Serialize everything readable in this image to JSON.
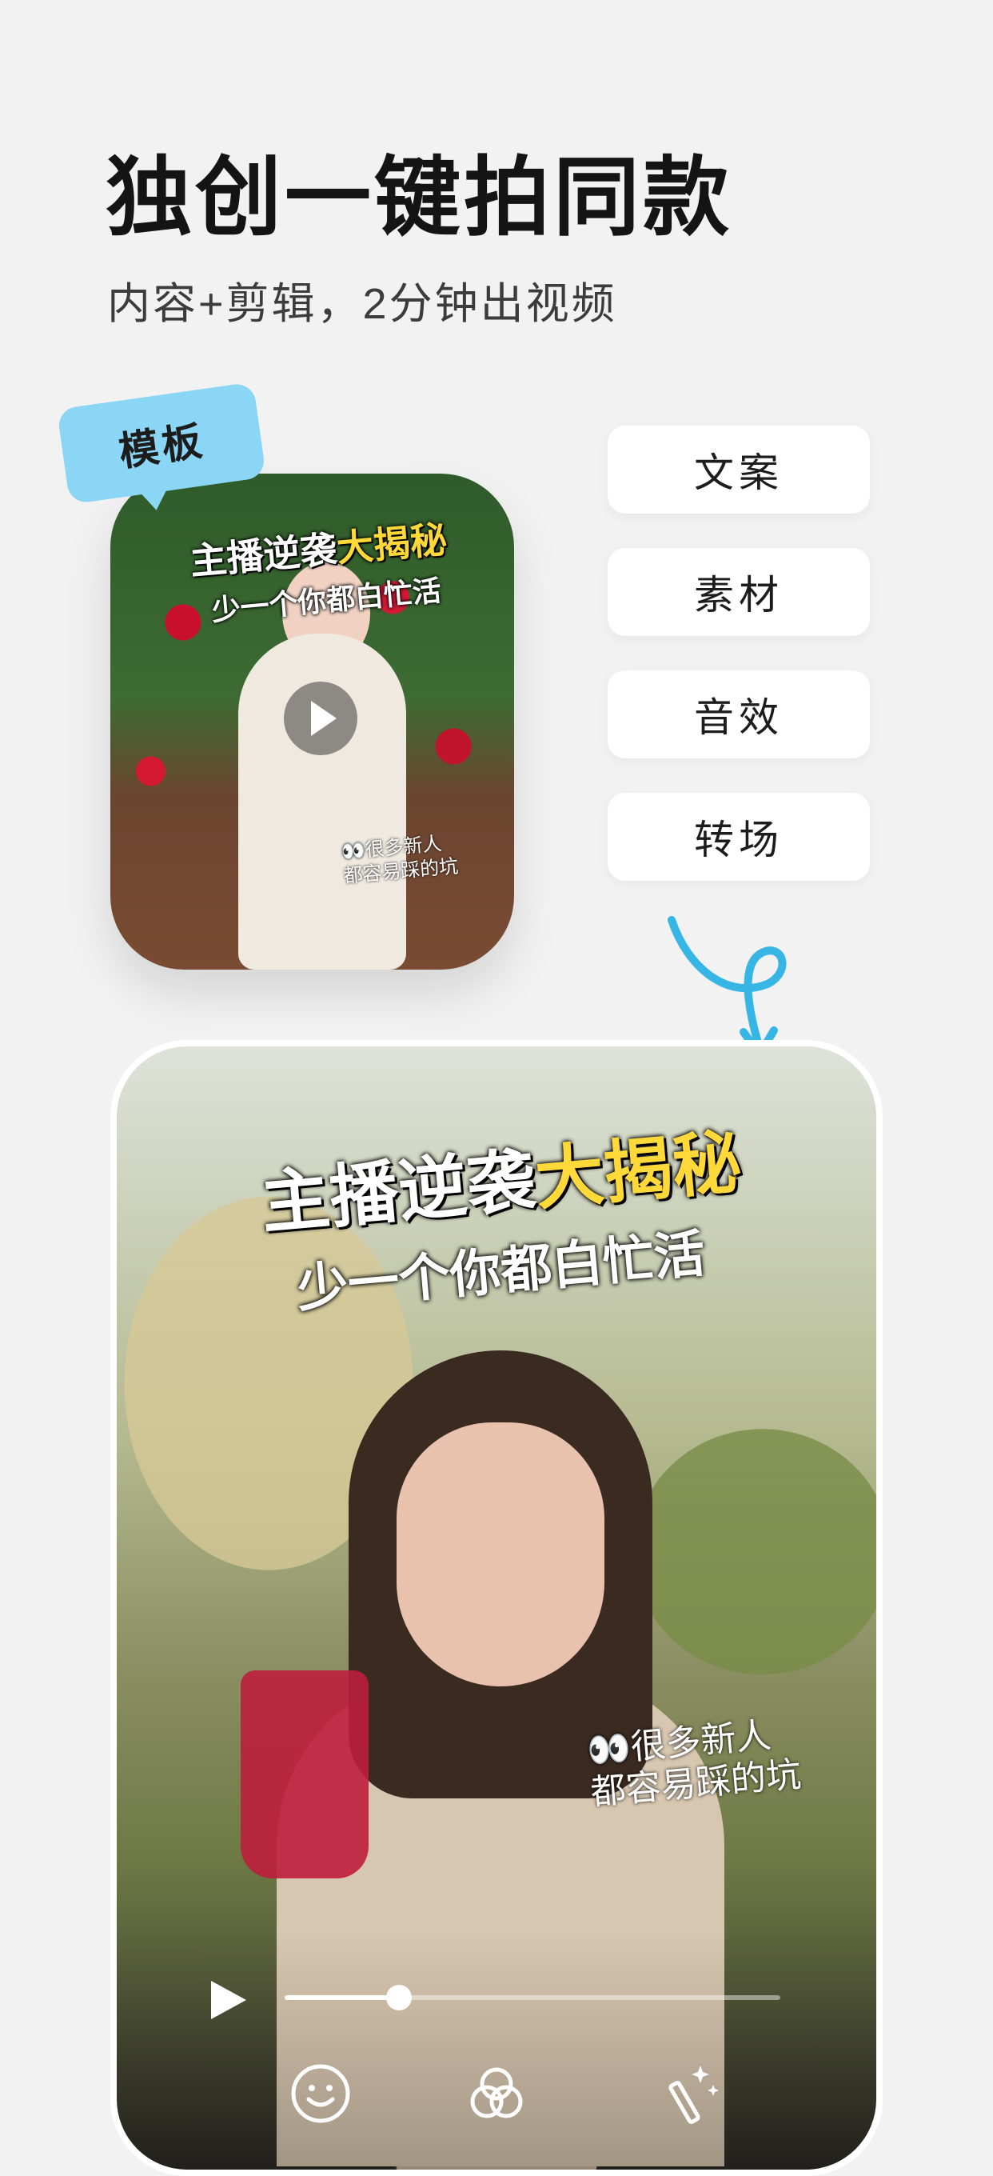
{
  "headline": "独创一键拍同款",
  "subtitle": "内容+剪辑，2分钟出视频",
  "template_tag": "模板",
  "template_card": {
    "caption_line1_a": "主播逆袭",
    "caption_line1_b": "大揭秘",
    "caption_line2": "少一个你都白忙活",
    "note": "👀很多新人\n都容易踩的坑"
  },
  "options": [
    "文案",
    "素材",
    "音效",
    "转场"
  ],
  "video": {
    "caption_line1_a": "主播逆袭",
    "caption_line1_b": "大揭秘",
    "caption_line2": "少一个你都白忙活",
    "note": "👀很多新人\n都容易踩的坑",
    "progress": 0.23
  },
  "tools": [
    "emoji-icon",
    "filter-icon",
    "magic-wand-icon"
  ],
  "colors": {
    "tag": "#8ad6f4",
    "accent_arrow": "#37b6e5",
    "highlight_text": "#ffd83a"
  }
}
